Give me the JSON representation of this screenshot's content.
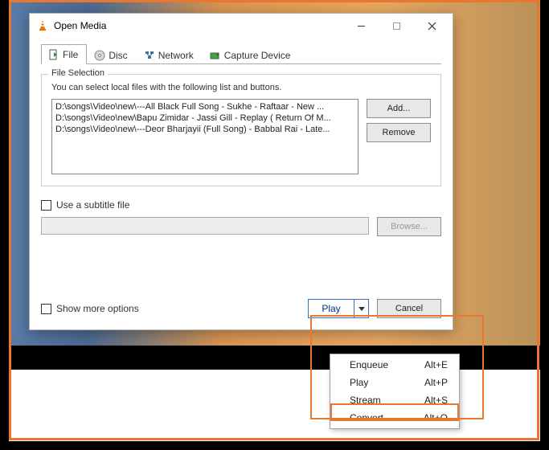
{
  "window": {
    "title": "Open Media"
  },
  "tabs": {
    "file": "File",
    "disc": "Disc",
    "network": "Network",
    "capture": "Capture Device"
  },
  "file_selection": {
    "legend": "File Selection",
    "hint": "You can select local files with the following list and buttons.",
    "files": [
      "D:\\songs\\Video\\new\\---All Black Full Song - Sukhe - Raftaar -  New ...",
      "D:\\songs\\Video\\new\\Bapu Zimidar - Jassi Gill - Replay ( Return Of M...",
      "D:\\songs\\Video\\new\\---Deor Bharjayii (Full Song) - Babbal Rai - Late..."
    ],
    "add_btn": "Add...",
    "remove_btn": "Remove"
  },
  "subtitle": {
    "checkbox_label": "Use a subtitle file",
    "browse_btn": "Browse..."
  },
  "show_more": "Show more options",
  "actions": {
    "play": "Play",
    "cancel": "Cancel"
  },
  "dropdown": [
    {
      "label": "Enqueue",
      "shortcut": "Alt+E"
    },
    {
      "label": "Play",
      "shortcut": "Alt+P"
    },
    {
      "label": "Stream",
      "shortcut": "Alt+S"
    },
    {
      "label": "Convert",
      "shortcut": "Alt+O"
    }
  ]
}
